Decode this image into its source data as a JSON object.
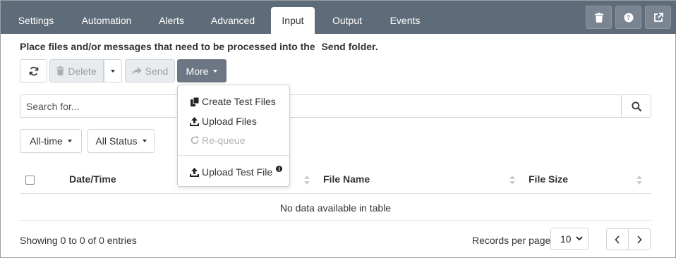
{
  "tabs": [
    {
      "label": "Settings"
    },
    {
      "label": "Automation"
    },
    {
      "label": "Alerts"
    },
    {
      "label": "Advanced"
    },
    {
      "label": "Input",
      "active": true
    },
    {
      "label": "Output"
    },
    {
      "label": "Events"
    }
  ],
  "top_buttons": [
    {
      "icon": "trash-icon"
    },
    {
      "icon": "help-icon",
      "glyph": "?"
    },
    {
      "icon": "external-link-icon"
    }
  ],
  "instruction": {
    "prefix": "Place files and/or messages that need to be processed into the",
    "folder_name": "Send",
    "suffix": "folder."
  },
  "toolbar": {
    "refresh_icon": "refresh-icon",
    "delete_label": "Delete",
    "send_label": "Send",
    "more_label": "More"
  },
  "more_menu": {
    "items": [
      {
        "label": "Create Test Files",
        "icon": "copy-icon",
        "enabled": true
      },
      {
        "label": "Upload Files",
        "icon": "upload-icon",
        "enabled": true
      },
      {
        "label": "Re-queue",
        "icon": "redo-icon",
        "enabled": false
      },
      {
        "label": "Upload Test File",
        "icon": "upload-icon",
        "enabled": true,
        "badge_icon": "info-icon",
        "badge_glyph": "i"
      }
    ]
  },
  "search": {
    "placeholder": "Search for...",
    "value": ""
  },
  "filters": {
    "time": "All-time",
    "status": "All Status"
  },
  "table": {
    "columns": [
      "Date/Time",
      "File Name",
      "File Size"
    ],
    "empty_message": "No data available in table",
    "rows": []
  },
  "footer": {
    "showing": "Showing 0 to 0 of 0 entries",
    "records_per_page_label": "Records per page:",
    "records_per_page_value": "10"
  },
  "colors": {
    "tabbar": "#5e6b78",
    "more_button": "#6c7783",
    "disabled_text": "#9aa0a6"
  }
}
